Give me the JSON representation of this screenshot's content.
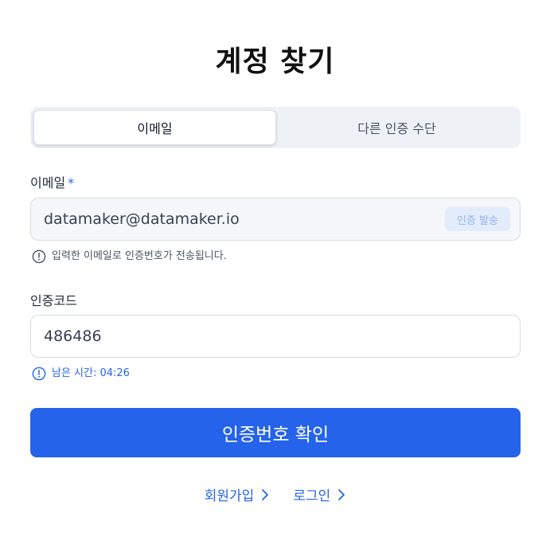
{
  "page": {
    "title": "계정 찾기"
  },
  "tabs": [
    {
      "label": "이메일",
      "active": true
    },
    {
      "label": "다른 인증 수단",
      "active": false
    }
  ],
  "email": {
    "label": "이메일",
    "required_mark": "*",
    "value": "datamaker@datamaker.io",
    "send_button": "인증 발송",
    "hint": "입력한 이메일로 인증번호가 전송됩니다."
  },
  "code": {
    "label": "인증코드",
    "value": "486486",
    "timer_hint": "남은 시간: 04:26"
  },
  "actions": {
    "confirm_label": "인증번호 확인"
  },
  "links": {
    "signup": "회원가입",
    "login": "로그인"
  },
  "colors": {
    "accent": "#2563eb",
    "tab_background": "#eef2f7",
    "readonly_field": "#f5f7fa"
  }
}
